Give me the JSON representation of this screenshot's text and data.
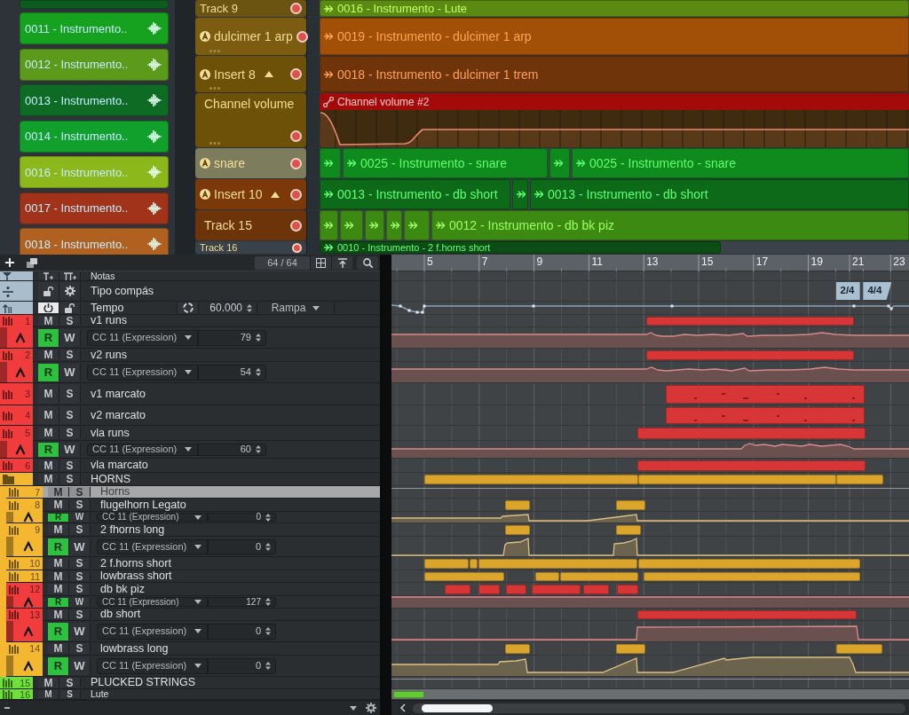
{
  "playlist": {
    "patterns": [
      {
        "color": "#0d5c1f"
      },
      {
        "label": "0011 - Instrumento..",
        "color": "#16a11e"
      },
      {
        "label": "0012 - Instrumento..",
        "color": "#5b9a1a"
      },
      {
        "label": "0013 - Instrumento..",
        "color": "#0e6b24"
      },
      {
        "label": "0014 - Instrumento..",
        "color": "#12a02c"
      },
      {
        "label": "0016 - Instrumento..",
        "color": "#8db81c"
      },
      {
        "label": "0017 - Instrumento..",
        "color": "#a1331b"
      },
      {
        "label": "0018 - Instrumento..",
        "color": "#b0601f"
      }
    ],
    "tracks": [
      {
        "name": "Track 9",
        "color": "#6b5311",
        "badge": false,
        "clips": [
          {
            "label": "0016 - Instrumento - Lute",
            "color": "#5b8a12"
          }
        ]
      },
      {
        "name": "dulcimer 1 arp",
        "color": "#7b5c10",
        "badge": true,
        "clips": [
          {
            "label": "0019 - Instrumento - dulcimer 1 arp",
            "color": "#a24f08"
          }
        ]
      },
      {
        "name": "Insert 8",
        "color": "#6d5109",
        "badge": true,
        "expanded": true,
        "clips": [
          {
            "label": "0018 - Instrumento - dulcimer 1 trem",
            "color": "#6f3409"
          }
        ],
        "children": [
          {
            "name": "Channel volume",
            "color": "#6d5109",
            "badge": false,
            "automation": {
              "label": "Channel volume #2",
              "color": "#a30b0b"
            }
          }
        ]
      },
      {
        "name": "snare",
        "color": "#7d7d5d",
        "badge": true,
        "clips": [
          {
            "color": "#0f8a1c"
          },
          {
            "label": "0025 - Instrumento - snare",
            "color": "#0f8a1c"
          },
          {
            "color": "#0f8a1c"
          },
          {
            "label": "0025 - Instrumento - snare",
            "color": "#0f8a1c"
          }
        ]
      },
      {
        "name": "Insert 10",
        "color": "#7b3909",
        "badge": true,
        "expanded": true,
        "clips": [
          {
            "label": "0013 - Instrumento - db short",
            "color": "#0c6a19"
          },
          {
            "color": "#0c6a19"
          },
          {
            "label": "0013 - Instrumento - db short",
            "color": "#0c6a19"
          }
        ],
        "children": [
          {
            "name": "Track 15",
            "color": "#6e3409",
            "badge": false,
            "clips": [
              {
                "color": "#3d8a12"
              },
              {
                "color": "#3d8a12"
              },
              {
                "color": "#3d8a12"
              },
              {
                "color": "#3d8a12"
              },
              {
                "color": "#3d8a12"
              },
              {
                "label": "0012 - Instrumento - db bk piz",
                "color": "#3d8a12"
              }
            ]
          }
        ]
      },
      {
        "name": "Track 16",
        "color": "#3a4249",
        "badge": false,
        "clips": [
          {
            "label": "0010 - Instrumento - 2 f.horns short",
            "color": "#0b4d14"
          }
        ]
      }
    ]
  },
  "project": {
    "toolbar": {
      "counter": "64 / 64"
    },
    "ruler": [
      "5",
      "7",
      "9",
      "11",
      "13",
      "15",
      "17",
      "19",
      "21",
      "23"
    ],
    "tracks": [
      {
        "kind": "marker",
        "name": "Notas",
        "selected": false
      },
      {
        "kind": "signature",
        "name": "Tipo compás",
        "selected": false,
        "events": [
          "2/4",
          "4/4"
        ]
      },
      {
        "kind": "tempo",
        "name": "Tempo",
        "selected": false,
        "on": true,
        "value": "60.000",
        "mode": "Rampa"
      },
      {
        "kind": "instrument",
        "number": "1",
        "name": "v1 runs",
        "color": "#f03c3c",
        "selected": false,
        "buttons": [
          {
            "label": "M",
            "on": false
          },
          {
            "label": "S",
            "on": false
          }
        ],
        "automation": {
          "parameter": "CC 11 (Expression)",
          "value": "79",
          "buttons": [
            {
              "label": "R",
              "on": true
            },
            {
              "label": "W",
              "on": false
            }
          ]
        }
      },
      {
        "kind": "instrument",
        "number": "2",
        "name": "v2 runs",
        "color": "#f03c3c",
        "selected": false,
        "buttons": [
          {
            "label": "M",
            "on": false
          },
          {
            "label": "S",
            "on": false
          }
        ],
        "automation": {
          "parameter": "CC 11 (Expression)",
          "value": "54",
          "buttons": [
            {
              "label": "R",
              "on": true
            },
            {
              "label": "W",
              "on": false
            }
          ]
        }
      },
      {
        "kind": "instrument",
        "number": "3",
        "name": "v1 marcato",
        "color": "#f03c3c",
        "selected": false,
        "buttons": [
          {
            "label": "M",
            "on": false
          },
          {
            "label": "S",
            "on": false
          }
        ]
      },
      {
        "kind": "instrument",
        "number": "4",
        "name": "v2 marcato",
        "color": "#f03c3c",
        "selected": false,
        "buttons": [
          {
            "label": "M",
            "on": false
          },
          {
            "label": "S",
            "on": false
          }
        ]
      },
      {
        "kind": "instrument",
        "number": "5",
        "name": "vla runs",
        "color": "#f03c3c",
        "selected": false,
        "buttons": [
          {
            "label": "M",
            "on": false
          },
          {
            "label": "S",
            "on": false
          }
        ],
        "automation": {
          "parameter": "CC 11 (Expression)",
          "value": "60",
          "buttons": [
            {
              "label": "R",
              "on": true
            },
            {
              "label": "W",
              "on": false
            }
          ]
        }
      },
      {
        "kind": "instrument",
        "number": "6",
        "name": "vla marcato",
        "color": "#f03c3c",
        "selected": false,
        "buttons": [
          {
            "label": "M",
            "on": false
          },
          {
            "label": "S",
            "on": false
          }
        ]
      },
      {
        "kind": "folder",
        "name": "HORNS",
        "color": "#f3b730",
        "selected": false,
        "buttons": [
          {
            "label": "M",
            "on": false
          },
          {
            "label": "S",
            "on": false
          }
        ],
        "children": [
          {
            "kind": "instrument",
            "number": "7",
            "name": "Horns",
            "color": "#f3b730",
            "selected": true,
            "buttons": [
              {
                "label": "M",
                "on": false
              },
              {
                "label": "S",
                "on": false
              }
            ]
          },
          {
            "kind": "instrument",
            "number": "8",
            "name": "flugelhorn Legato",
            "color": "#f3b730",
            "selected": false,
            "buttons": [
              {
                "label": "M",
                "on": false
              },
              {
                "label": "S",
                "on": false
              }
            ],
            "automation": {
              "parameter": "CC 11 (Expression)",
              "value": "0",
              "buttons": [
                {
                  "label": "R",
                  "on": true
                },
                {
                  "label": "W",
                  "on": false
                }
              ]
            }
          },
          {
            "kind": "instrument",
            "number": "9",
            "name": "2 fhorns long",
            "color": "#f3b730",
            "selected": false,
            "buttons": [
              {
                "label": "M",
                "on": false
              },
              {
                "label": "S",
                "on": false
              }
            ],
            "automation": {
              "parameter": "CC 11 (Expression)",
              "value": "0",
              "buttons": [
                {
                  "label": "R",
                  "on": true
                },
                {
                  "label": "W",
                  "on": false
                }
              ]
            }
          },
          {
            "kind": "instrument",
            "number": "10",
            "name": "2 f.horns short",
            "color": "#f3b730",
            "selected": false,
            "buttons": [
              {
                "label": "M",
                "on": false
              },
              {
                "label": "S",
                "on": false
              }
            ]
          },
          {
            "kind": "instrument",
            "number": "11",
            "name": "lowbrass short",
            "color": "#f3b730",
            "selected": false,
            "buttons": [
              {
                "label": "M",
                "on": false
              },
              {
                "label": "S",
                "on": false
              }
            ]
          },
          {
            "kind": "instrument",
            "number": "12",
            "name": "db bk piz",
            "color": "#f03c3c",
            "selected": false,
            "buttons": [
              {
                "label": "M",
                "on": false
              },
              {
                "label": "S",
                "on": false
              }
            ],
            "automation": {
              "parameter": "CC 11 (Expression)",
              "value": "127",
              "buttons": [
                {
                  "label": "R",
                  "on": true
                },
                {
                  "label": "W",
                  "on": false
                }
              ]
            }
          },
          {
            "kind": "instrument",
            "number": "13",
            "name": "db short",
            "color": "#f03c3c",
            "selected": false,
            "buttons": [
              {
                "label": "M",
                "on": false
              },
              {
                "label": "S",
                "on": false
              }
            ],
            "automation": {
              "parameter": "CC 11 (Expression)",
              "value": "0",
              "buttons": [
                {
                  "label": "R",
                  "on": true
                },
                {
                  "label": "W",
                  "on": false
                }
              ]
            }
          },
          {
            "kind": "instrument",
            "number": "14",
            "name": "lowbrass long",
            "color": "#f3b730",
            "selected": false,
            "buttons": [
              {
                "label": "M",
                "on": false
              },
              {
                "label": "S",
                "on": false
              }
            ],
            "automation": {
              "parameter": "CC 11 (Expression)",
              "value": "0",
              "buttons": [
                {
                  "label": "R",
                  "on": true
                },
                {
                  "label": "W",
                  "on": false
                }
              ]
            }
          }
        ]
      },
      {
        "kind": "instrument",
        "number": "15",
        "name": "PLUCKED STRINGS",
        "color": "#6fe03a",
        "selected": false,
        "buttons": [
          {
            "label": "M",
            "on": false
          },
          {
            "label": "S",
            "on": false
          }
        ]
      },
      {
        "kind": "instrument",
        "number": "16",
        "name": "Lute",
        "color": "#6fe03a",
        "selected": false,
        "buttons": [
          {
            "label": "M",
            "on": false
          },
          {
            "label": "S",
            "on": false
          }
        ]
      }
    ]
  }
}
